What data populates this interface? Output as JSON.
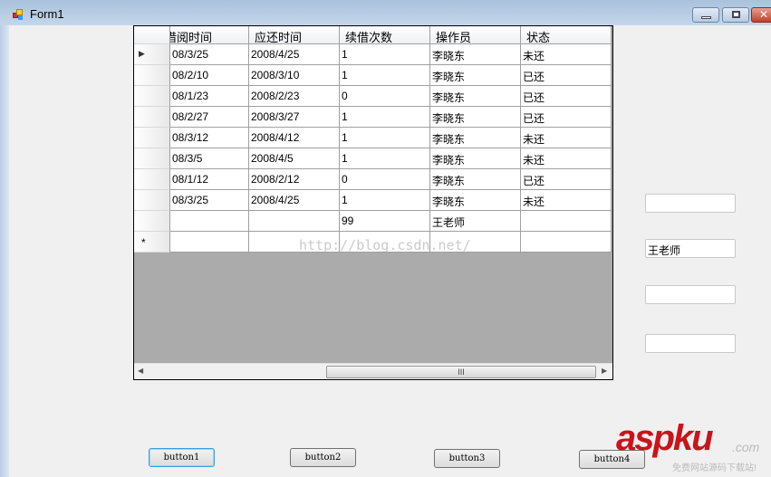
{
  "window": {
    "title": "Form1"
  },
  "grid": {
    "columns": [
      "借阅时间",
      "应还时间",
      "续借次数",
      "操作员",
      "状态"
    ],
    "rows": [
      [
        "08/3/25",
        "2008/4/25",
        "1",
        "李晓东",
        "未还"
      ],
      [
        "08/2/10",
        "2008/3/10",
        "1",
        "李晓东",
        "已还"
      ],
      [
        "08/1/23",
        "2008/2/23",
        "0",
        "李晓东",
        "已还"
      ],
      [
        "08/2/27",
        "2008/3/27",
        "1",
        "李晓东",
        "已还"
      ],
      [
        "08/3/12",
        "2008/4/12",
        "1",
        "李晓东",
        "未还"
      ],
      [
        "08/3/5",
        "2008/4/5",
        "1",
        "李晓东",
        "未还"
      ],
      [
        "08/1/12",
        "2008/2/12",
        "0",
        "李晓东",
        "已还"
      ],
      [
        "08/3/25",
        "2008/4/25",
        "1",
        "李晓东",
        "未还"
      ],
      [
        "",
        "",
        "99",
        "王老师",
        ""
      ]
    ],
    "new_row_marker": "*",
    "scroll_grip": "III"
  },
  "textboxes": [
    "",
    "王老师",
    "",
    ""
  ],
  "buttons": [
    "button1",
    "button2",
    "button3",
    "button4"
  ],
  "watermark": "http://blog.csdn.net/",
  "logo": {
    "text": "aspku",
    ".com": ".com",
    "tagline": "免费网站源码下载站!"
  }
}
